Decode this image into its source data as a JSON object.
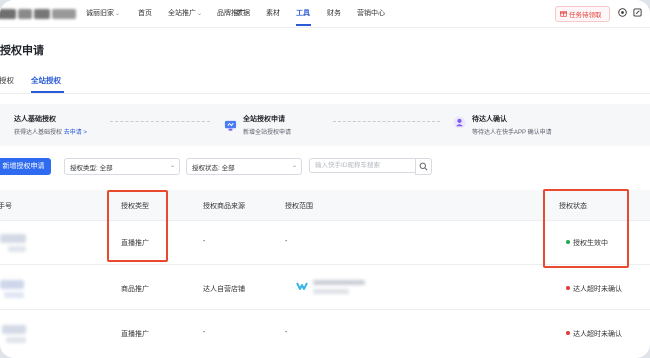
{
  "topnav": {
    "shop_name": "诚丽旧家",
    "items": [
      {
        "label": "首页",
        "has_dropdown": false,
        "active": false
      },
      {
        "label": "全站推广",
        "has_dropdown": true,
        "active": false
      },
      {
        "label": "品牌推广",
        "has_dropdown": false,
        "active": false
      },
      {
        "label": "数据",
        "has_dropdown": false,
        "active": false
      },
      {
        "label": "素材",
        "has_dropdown": false,
        "active": false
      },
      {
        "label": "工具",
        "has_dropdown": false,
        "active": true
      },
      {
        "label": "财务",
        "has_dropdown": false,
        "active": false
      },
      {
        "label": "营销中心",
        "has_dropdown": false,
        "active": false
      }
    ],
    "task_button": "任务待领取",
    "icons": [
      "gift-icon",
      "help-icon",
      "edit-icon"
    ]
  },
  "page": {
    "title": "授权申请",
    "tabs": [
      {
        "label": "授权",
        "active": false
      },
      {
        "label": "全站授权",
        "active": true
      }
    ]
  },
  "steps": [
    {
      "title": "达人基础授权",
      "desc": "获得达人基础授权",
      "link": "去申请 >",
      "icon": "authorize-icon"
    },
    {
      "title": "全站授权申请",
      "desc": "新增全站授权申请",
      "link": "",
      "icon": "monitor-icon"
    },
    {
      "title": "待达人确认",
      "desc": "等待达人在快手APP 确认申请",
      "link": "",
      "icon": "user-confirm-icon"
    }
  ],
  "filters": {
    "add_button": "新增授权申请",
    "type_select": "授权类型: 全部",
    "status_select": "授权状态: 全部",
    "search_placeholder": "输入快手ID昵称车搜索"
  },
  "table": {
    "columns": [
      "手号",
      "授权类型",
      "授权商品来源",
      "授权范围",
      "授权状态"
    ],
    "rows": [
      {
        "type": "直播推广",
        "source": "-",
        "scope": "-",
        "status": "授权生效中",
        "status_color": "#1faa52"
      },
      {
        "type": "商品推广",
        "source": "达人自营店铺",
        "scope": "",
        "status": "达人超时未确认",
        "status_color": "#e23c3c"
      },
      {
        "type": "直播推广",
        "source": "-",
        "scope": "-",
        "status": "达人超时未确认",
        "status_color": "#e23c3c"
      }
    ]
  },
  "colors": {
    "primary": "#2f6bf0",
    "active_nav": "#2a5bd7",
    "highlight": "#e8492f",
    "ok": "#1faa52",
    "warn": "#e23c3c"
  }
}
